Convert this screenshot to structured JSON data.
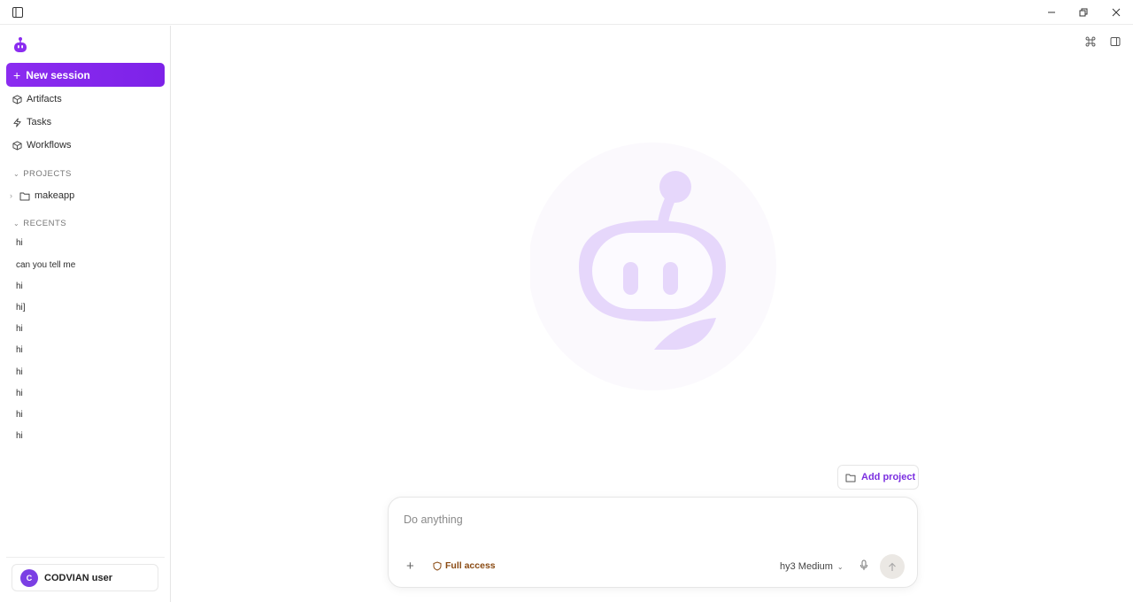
{
  "titlebar": {
    "toggle_sidebar_icon": "sidebar-toggle-icon",
    "controls": [
      "minimize-icon",
      "restore-icon",
      "close-icon"
    ]
  },
  "sidebar": {
    "new_session_label": "New session",
    "nav": [
      {
        "label": "Artifacts",
        "icon": "cube-icon"
      },
      {
        "label": "Tasks",
        "icon": "lightning-icon"
      },
      {
        "label": "Workflows",
        "icon": "cube-icon"
      }
    ],
    "projects_heading": "PROJECTS",
    "projects": [
      {
        "label": "makeapp",
        "icon": "folder-icon"
      }
    ],
    "recents_heading": "RECENTS",
    "recents": [
      "hi",
      "can you tell me",
      "hi",
      "hi]",
      "hi",
      "hi",
      "hi",
      "hi",
      "hi",
      "hi"
    ],
    "user": {
      "initial": "C",
      "name": "CODVIAN user"
    }
  },
  "main": {
    "add_project_label": "Add project",
    "composer": {
      "placeholder": "Do anything",
      "access_label": "Full access",
      "model_label": "hy3 Medium"
    }
  },
  "colors": {
    "accent": "#8b2cf0",
    "hero_fill": "#e6d7fb",
    "access": "#8a4a12"
  }
}
